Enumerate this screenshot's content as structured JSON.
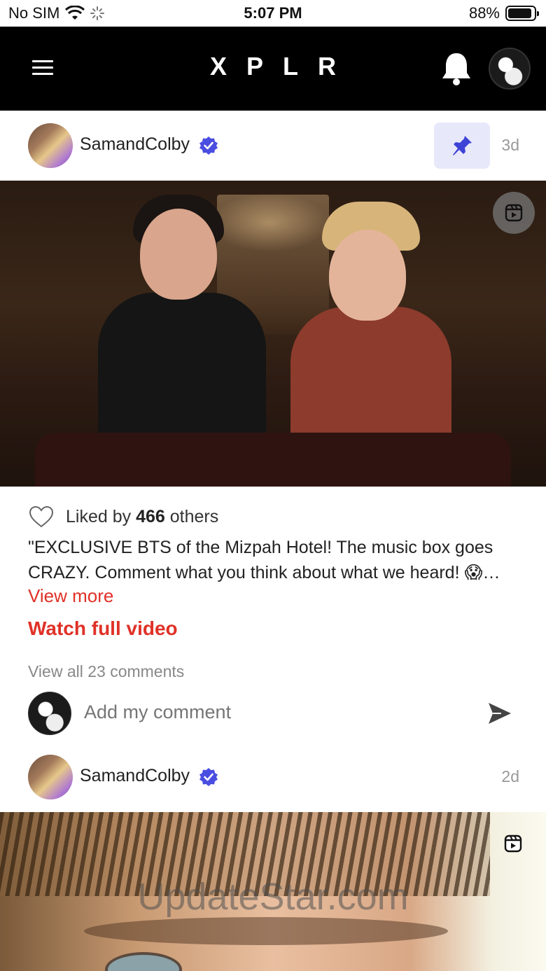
{
  "status_bar": {
    "carrier": "No SIM",
    "time": "5:07 PM",
    "battery": "88%"
  },
  "header": {
    "brand": "XPLR"
  },
  "posts": [
    {
      "author": "SamandColby",
      "age": "3d",
      "pinned": true,
      "likes_prefix": "Liked by",
      "likes_count": "466",
      "likes_suffix": "others",
      "caption": "\"EXCLUSIVE BTS of the Mizpah Hotel! The music box goes CRAZY. Comment what you think about what we heard! 😱…",
      "view_more": "View more",
      "watch_full": "Watch full video",
      "view_comments": "View all 23 comments",
      "comment_placeholder": "Add my comment"
    },
    {
      "author": "SamandColby",
      "age": "2d",
      "watermark": "UpdateStar.com"
    }
  ],
  "colors": {
    "accent_red": "#e03127",
    "verified_blue": "#4a4ee0",
    "pin_bg": "#e8e8fb"
  }
}
